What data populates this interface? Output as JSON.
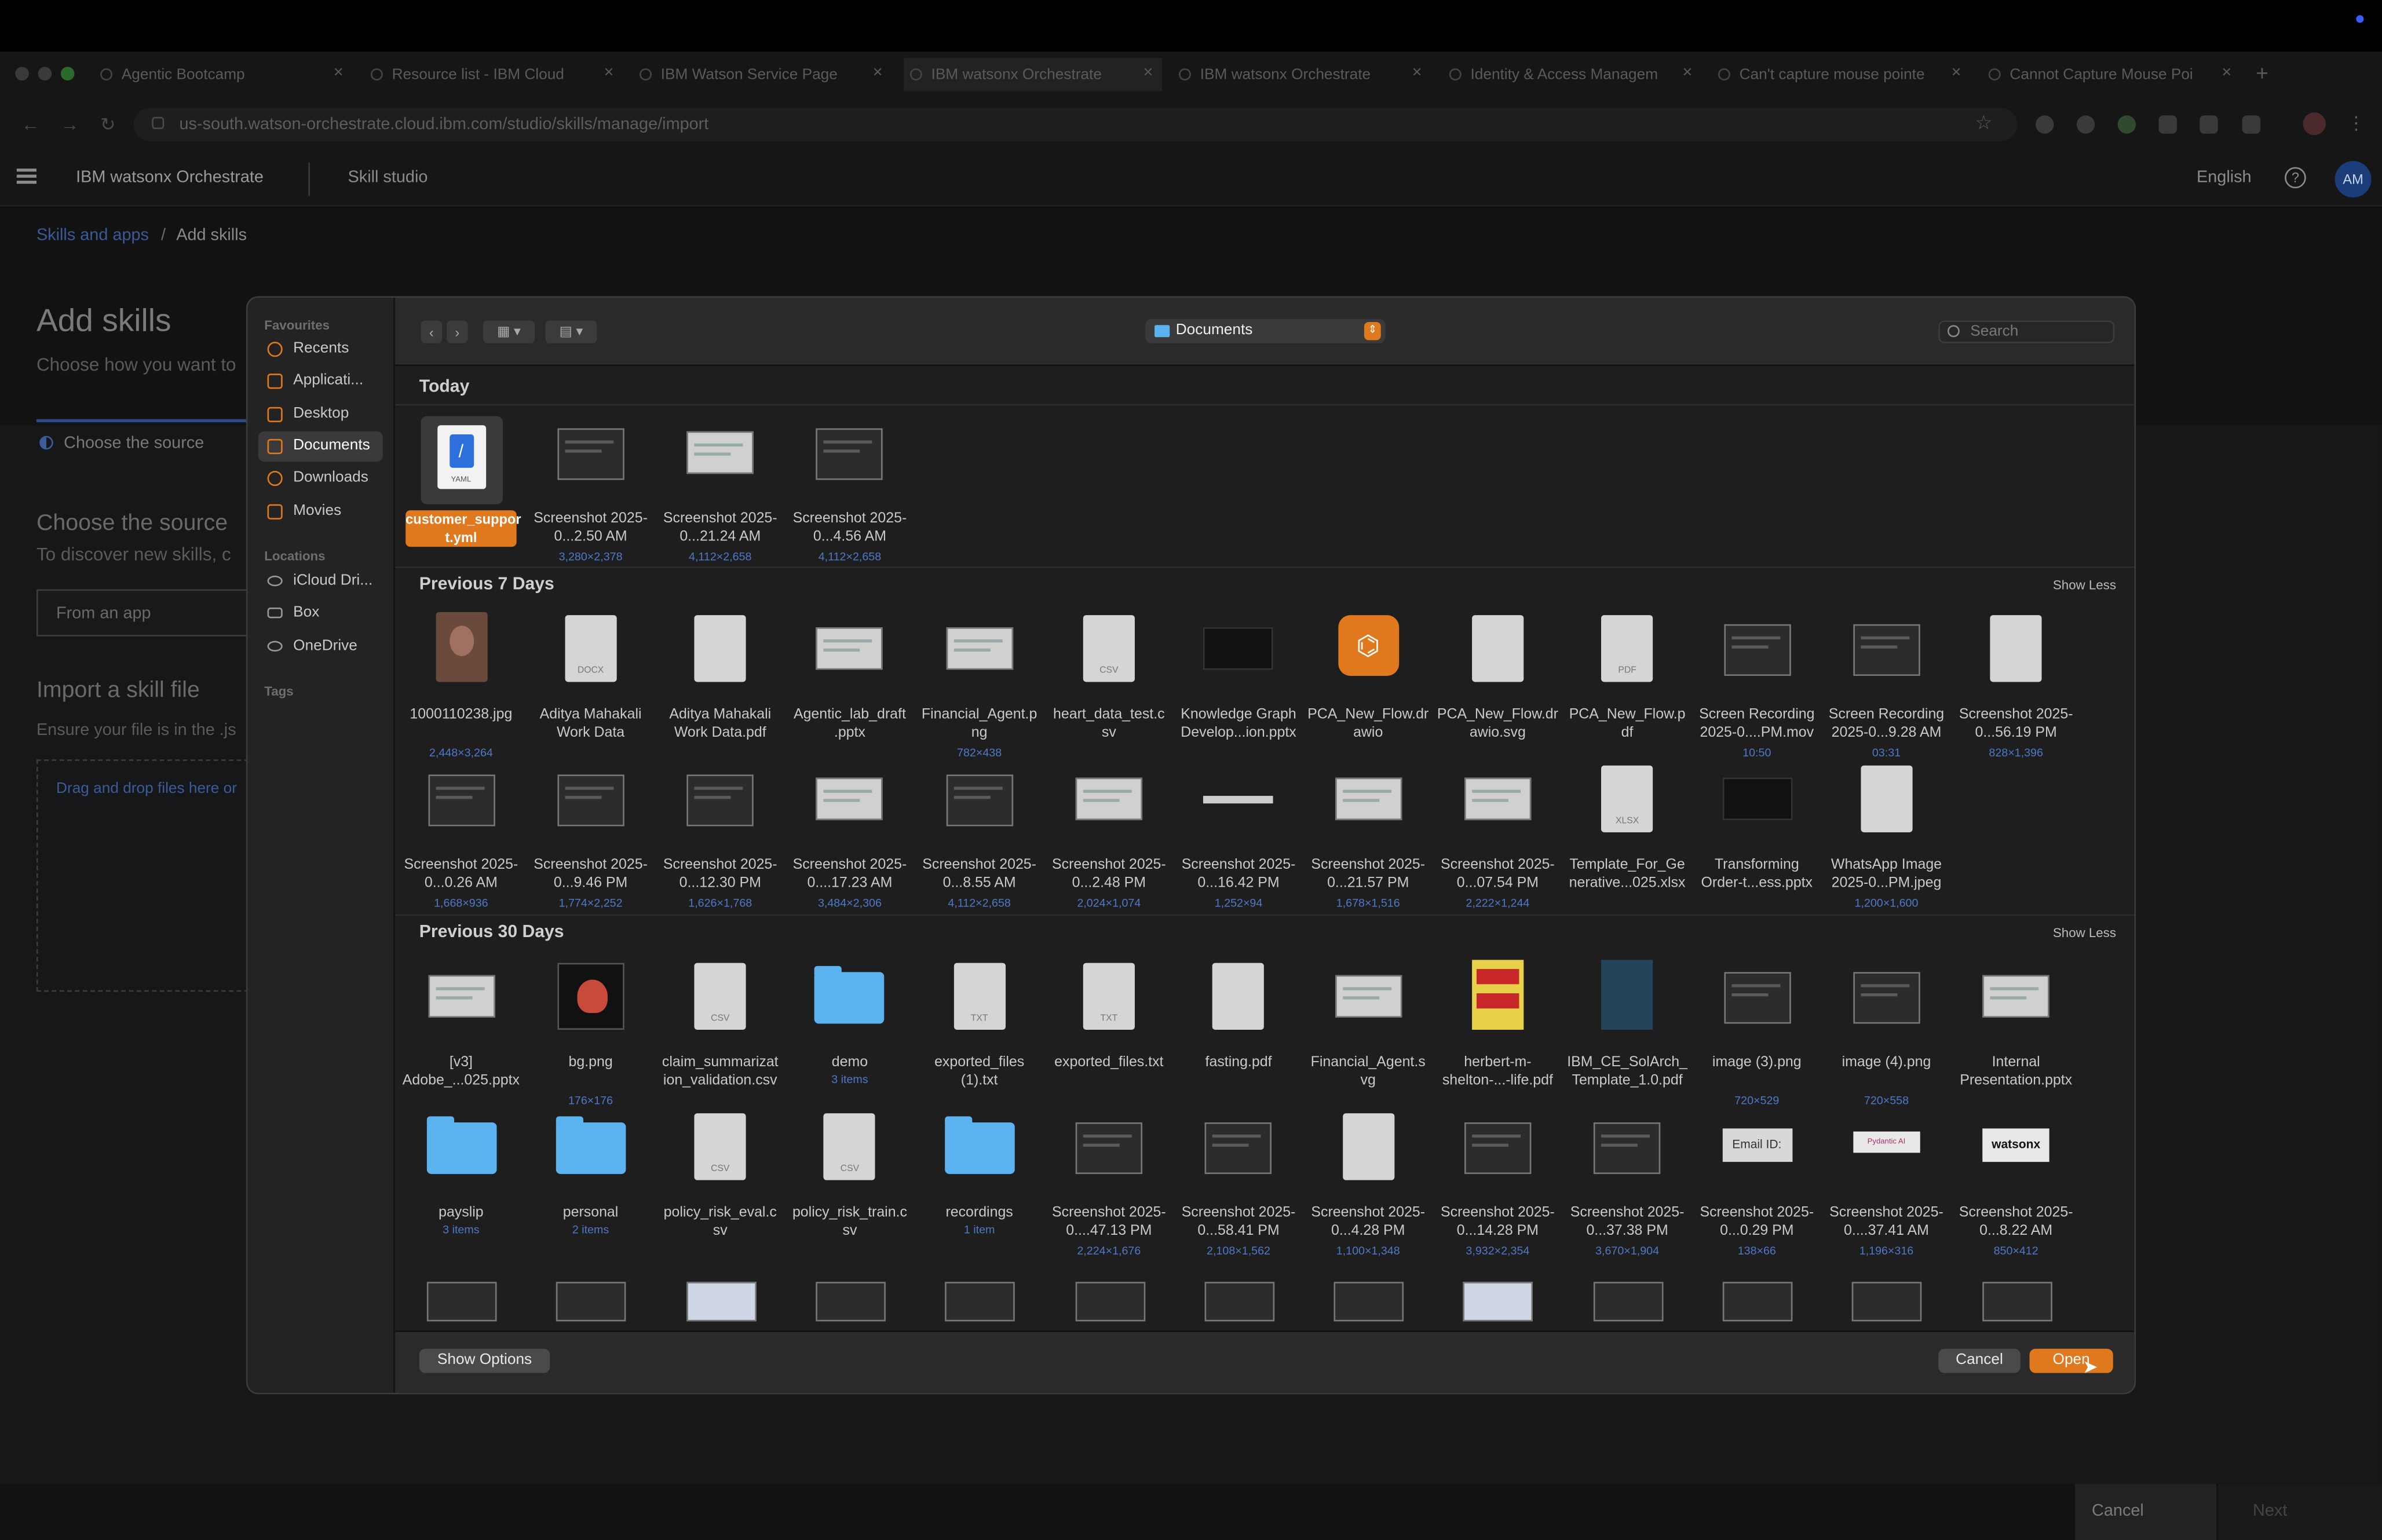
{
  "browser": {
    "tabs": [
      "Agentic Bootcamp",
      "Resource list - IBM Cloud",
      "IBM Watson Service Page",
      "IBM watsonx Orchestrate",
      "IBM watsonx Orchestrate",
      "Identity & Access Managem",
      "Can't capture mouse pointe",
      "Cannot Capture Mouse Poi"
    ],
    "new_tab": "+",
    "url": "us-south.watson-orchestrate.cloud.ibm.com/studio/skills/manage/import"
  },
  "app": {
    "brand": "IBM watsonx Orchestrate",
    "section": "Skill studio",
    "language": "English",
    "avatar": "AM"
  },
  "page": {
    "breadcrumb_root": "Skills and apps",
    "breadcrumb_sep": "/",
    "breadcrumb_current": "Add skills",
    "title": "Add skills",
    "subtitle": "Choose how you want to",
    "step": "Choose the source",
    "source_title": "Choose the source",
    "source_desc": "To discover new skills, c",
    "from_app": "From an app",
    "import_title": "Import a skill file",
    "import_desc": "Ensure your file is in the .js",
    "drop_text": "Drag and drop files here or",
    "cancel": "Cancel",
    "next": "Next"
  },
  "dialog": {
    "sidebar": {
      "favourites_label": "Favourites",
      "favourites": [
        "Recents",
        "Applicati...",
        "Desktop",
        "Documents",
        "Downloads",
        "Movies"
      ],
      "locations_label": "Locations",
      "locations": [
        "iCloud Dri...",
        "Box",
        "OneDrive"
      ],
      "tags_label": "Tags"
    },
    "location": "Documents",
    "search_placeholder": "Search",
    "show_less": "Show Less",
    "sections": {
      "today": "Today",
      "prev7": "Previous 7 Days",
      "prev30": "Previous 30 Days"
    },
    "today_items": [
      {
        "name": "customer_suppor t.yml",
        "sub": "",
        "kind": "yaml"
      },
      {
        "name": "Screenshot 2025-0...2.50 AM",
        "sub": "3,280×2,378",
        "kind": "shot"
      },
      {
        "name": "Screenshot 2025-0...21.24 AM",
        "sub": "4,112×2,658",
        "kind": "shotlight"
      },
      {
        "name": "Screenshot 2025-0...4.56 AM",
        "sub": "4,112×2,658",
        "kind": "shot"
      }
    ],
    "prev7_row1": [
      {
        "name": "1000110238.jpg",
        "sub": "2,448×3,264",
        "kind": "photo"
      },
      {
        "name": "Aditya Mahakali Work Data",
        "sub": "",
        "kind": "doc",
        "lbl": "DOCX"
      },
      {
        "name": "Aditya Mahakali Work Data.pdf",
        "sub": "",
        "kind": "doc",
        "lbl": ""
      },
      {
        "name": "Agentic_lab_draft .pptx",
        "sub": "",
        "kind": "shotlight"
      },
      {
        "name": "Financial_Agent.p ng",
        "sub": "782×438",
        "kind": "shotlight"
      },
      {
        "name": "heart_data_test.c sv",
        "sub": "",
        "kind": "doc",
        "lbl": "CSV"
      },
      {
        "name": "Knowledge Graph Develop...ion.pptx",
        "sub": "",
        "kind": "dark"
      },
      {
        "name": "PCA_New_Flow.dr awio",
        "sub": "",
        "kind": "drawio"
      },
      {
        "name": "PCA_New_Flow.dr awio.svg",
        "sub": "",
        "kind": "doc",
        "lbl": ""
      },
      {
        "name": "PCA_New_Flow.p df",
        "sub": "",
        "kind": "doc",
        "lbl": "PDF"
      },
      {
        "name": "Screen Recording 2025-0....PM.mov",
        "sub": "10:50",
        "kind": "shot"
      },
      {
        "name": "Screen Recording 2025-0...9.28 AM",
        "sub": "03:31",
        "kind": "shot"
      },
      {
        "name": "Screenshot 2025-0...56.19 PM",
        "sub": "828×1,396",
        "kind": "doc",
        "lbl": ""
      }
    ],
    "prev7_row2": [
      {
        "name": "Screenshot 2025-0...0.26 AM",
        "sub": "1,668×936",
        "kind": "shot"
      },
      {
        "name": "Screenshot 2025-0...9.46 PM",
        "sub": "1,774×2,252",
        "kind": "shot"
      },
      {
        "name": "Screenshot 2025-0...12.30 PM",
        "sub": "1,626×1,768",
        "kind": "shot"
      },
      {
        "name": "Screenshot 2025-0....17.23 AM",
        "sub": "3,484×2,306",
        "kind": "shotlight"
      },
      {
        "name": "Screenshot 2025-0...8.55 AM",
        "sub": "4,112×2,658",
        "kind": "shot"
      },
      {
        "name": "Screenshot 2025-0...2.48 PM",
        "sub": "2,024×1,074",
        "kind": "shotlight"
      },
      {
        "name": "Screenshot 2025-0...16.42 PM",
        "sub": "1,252×94",
        "kind": "bar"
      },
      {
        "name": "Screenshot 2025-0...21.57 PM",
        "sub": "1,678×1,516",
        "kind": "shotlight"
      },
      {
        "name": "Screenshot 2025-0...07.54 PM",
        "sub": "2,222×1,244",
        "kind": "shotlight"
      },
      {
        "name": "Template_For_Ge nerative...025.xlsx",
        "sub": "",
        "kind": "doc",
        "lbl": "XLSX"
      },
      {
        "name": "Transforming Order-t...ess.pptx",
        "sub": "",
        "kind": "dark"
      },
      {
        "name": "WhatsApp Image 2025-0...PM.jpeg",
        "sub": "1,200×1,600",
        "kind": "doc",
        "lbl": ""
      }
    ],
    "prev30_row1": [
      {
        "name": "[v3] Adobe_...025.pptx",
        "sub": "",
        "kind": "shotlight"
      },
      {
        "name": "bg.png",
        "sub": "176×176",
        "kind": "logo"
      },
      {
        "name": "claim_summarizat ion_validation.csv",
        "sub": "",
        "kind": "doc",
        "lbl": "CSV"
      },
      {
        "name": "demo",
        "sub": "3 items",
        "kind": "folder"
      },
      {
        "name": "exported_files (1).txt",
        "sub": "",
        "kind": "doc",
        "lbl": "TXT"
      },
      {
        "name": "exported_files.txt",
        "sub": "",
        "kind": "doc",
        "lbl": "TXT"
      },
      {
        "name": "fasting.pdf",
        "sub": "",
        "kind": "doc",
        "lbl": ""
      },
      {
        "name": "Financial_Agent.s vg",
        "sub": "",
        "kind": "shotlight"
      },
      {
        "name": "herbert-m- shelton-...-life.pdf",
        "sub": "",
        "kind": "book"
      },
      {
        "name": "IBM_CE_SolArch_ Template_1.0.pdf",
        "sub": "",
        "kind": "book2"
      },
      {
        "name": "image (3).png",
        "sub": "720×529",
        "kind": "shot"
      },
      {
        "name": "image (4).png",
        "sub": "720×558",
        "kind": "shot"
      },
      {
        "name": "Internal Presentation.pptx",
        "sub": "",
        "kind": "shotlight"
      }
    ],
    "prev30_row2": [
      {
        "name": "payslip",
        "sub": "3 items",
        "kind": "folder"
      },
      {
        "name": "personal",
        "sub": "2 items",
        "kind": "folder"
      },
      {
        "name": "policy_risk_eval.c sv",
        "sub": "",
        "kind": "doc",
        "lbl": "CSV"
      },
      {
        "name": "policy_risk_train.c sv",
        "sub": "",
        "kind": "doc",
        "lbl": "CSV"
      },
      {
        "name": "recordings",
        "sub": "1 item",
        "kind": "folder"
      },
      {
        "name": "Screenshot 2025-0....47.13 PM",
        "sub": "2,224×1,676",
        "kind": "shot"
      },
      {
        "name": "Screenshot 2025-0...58.41 PM",
        "sub": "2,108×1,562",
        "kind": "shot"
      },
      {
        "name": "Screenshot 2025-0...4.28 PM",
        "sub": "1,100×1,348",
        "kind": "doc",
        "lbl": ""
      },
      {
        "name": "Screenshot 2025-0...14.28 PM",
        "sub": "3,932×2,354",
        "kind": "shot"
      },
      {
        "name": "Screenshot 2025-0...37.38 PM",
        "sub": "3,670×1,904",
        "kind": "shot"
      },
      {
        "name": "Screenshot 2025-0...0.29 PM",
        "sub": "138×66",
        "kind": "email",
        "label": "Email ID:"
      },
      {
        "name": "Screenshot 2025-0....37.41 AM",
        "sub": "1,196×316",
        "kind": "pyd",
        "label": "Pydantic AI"
      },
      {
        "name": "Screenshot 2025-0...8.22 AM",
        "sub": "850×412",
        "kind": "wx",
        "label": "watsonx"
      }
    ],
    "show_options": "Show Options",
    "cancel": "Cancel",
    "open": "Open"
  }
}
